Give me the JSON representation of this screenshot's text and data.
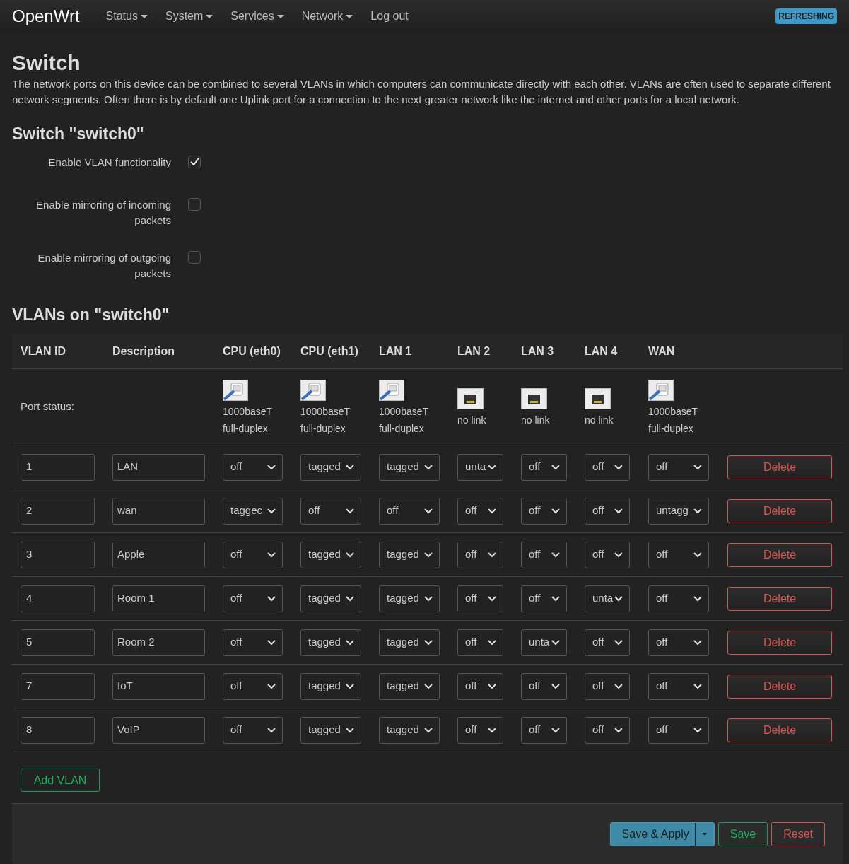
{
  "brand": "OpenWrt",
  "nav": [
    {
      "label": "Status",
      "dropdown": true
    },
    {
      "label": "System",
      "dropdown": true
    },
    {
      "label": "Services",
      "dropdown": true
    },
    {
      "label": "Network",
      "dropdown": true
    },
    {
      "label": "Log out",
      "dropdown": false
    }
  ],
  "badge": "REFRESHING",
  "page_title": "Switch",
  "description": "The network ports on this device can be combined to several VLANs in which computers can communicate directly with each other. VLANs are often used to separate different network segments. Often there is by default one Uplink port for a connection to the next greater network like the internet and other ports for a local network.",
  "switch_title": "Switch \"switch0\"",
  "options": [
    {
      "label": "Enable VLAN functionality",
      "checked": true
    },
    {
      "label": "Enable mirroring of incoming packets",
      "checked": false
    },
    {
      "label": "Enable mirroring of outgoing packets",
      "checked": false
    }
  ],
  "vlans_title": "VLANs on \"switch0\"",
  "table": {
    "columns": [
      "VLAN ID",
      "Description",
      "CPU (eth0)",
      "CPU (eth1)",
      "LAN 1",
      "LAN 2",
      "LAN 3",
      "LAN 4",
      "WAN"
    ],
    "port_status_label": "Port status:",
    "port_status": [
      {
        "link": true,
        "lines": [
          "1000baseT",
          "full-duplex"
        ]
      },
      {
        "link": true,
        "lines": [
          "1000baseT",
          "full-duplex"
        ]
      },
      {
        "link": true,
        "lines": [
          "1000baseT",
          "full-duplex"
        ]
      },
      {
        "link": false,
        "lines": [
          "no link"
        ]
      },
      {
        "link": false,
        "lines": [
          "no link"
        ]
      },
      {
        "link": false,
        "lines": [
          "no link"
        ]
      },
      {
        "link": true,
        "lines": [
          "1000baseT",
          "full-duplex"
        ]
      }
    ],
    "rows": [
      {
        "id": "1",
        "description": "LAN",
        "ports": [
          "off",
          "tagged",
          "tagged",
          "unta",
          "off",
          "off",
          "off"
        ],
        "action": "Delete"
      },
      {
        "id": "2",
        "description": "wan",
        "ports": [
          "taggec",
          "off",
          "off",
          "off",
          "off",
          "off",
          "untagg"
        ],
        "action": "Delete"
      },
      {
        "id": "3",
        "description": "Apple",
        "ports": [
          "off",
          "tagged",
          "tagged",
          "off",
          "off",
          "off",
          "off"
        ],
        "action": "Delete"
      },
      {
        "id": "4",
        "description": "Room 1",
        "ports": [
          "off",
          "tagged",
          "tagged",
          "off",
          "off",
          "unta",
          "off"
        ],
        "action": "Delete"
      },
      {
        "id": "5",
        "description": "Room 2",
        "ports": [
          "off",
          "tagged",
          "tagged",
          "off",
          "unta",
          "off",
          "off"
        ],
        "action": "Delete"
      },
      {
        "id": "7",
        "description": "IoT",
        "ports": [
          "off",
          "tagged",
          "tagged",
          "off",
          "off",
          "off",
          "off"
        ],
        "action": "Delete"
      },
      {
        "id": "8",
        "description": "VoIP",
        "ports": [
          "off",
          "tagged",
          "tagged",
          "off",
          "off",
          "off",
          "off"
        ],
        "action": "Delete"
      }
    ]
  },
  "add_button": "Add VLAN",
  "footer_buttons": [
    {
      "label": "Save & Apply",
      "kind": "apply"
    },
    {
      "label": "Save",
      "kind": "save"
    },
    {
      "label": "Reset",
      "kind": "reset"
    }
  ]
}
